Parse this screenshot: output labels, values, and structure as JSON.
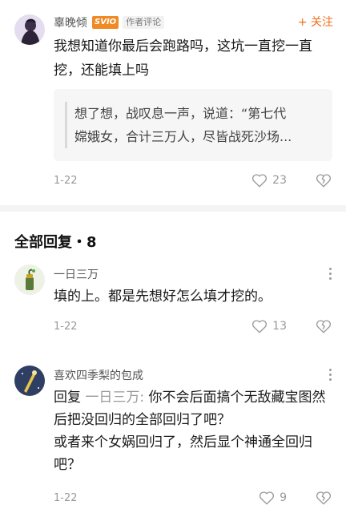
{
  "main_comment": {
    "author": "辜晚倾",
    "level_badge": "SVIO",
    "role_tag": "作者评论",
    "follow_label": "+ 关注",
    "text": "我想知道你最后会跑路吗，这坑一直挖一直挖，还能填上吗",
    "quote_line1": "想了想，战叹息一声，说道：“第七代",
    "quote_line2": "嫦娥女，合计三万人，尽皆战死沙场...",
    "date": "1-22",
    "likes": "23"
  },
  "replies_header": "全部回复・8",
  "replies": [
    {
      "author": "一日三万",
      "text": "填的上。都是先想好怎么填才挖的。",
      "date": "1-22",
      "likes": "13"
    },
    {
      "author": "喜欢四季梨的包成",
      "reply_prefix": "回复",
      "reply_target": "一日三万:",
      "text_line1": "你不会后面搞个无敌藏宝图然",
      "text_line2": "后把没回归的全部回归了吧？",
      "text_line3": "或者来个女娲回归了，然后显个神通全回归",
      "text_line4": "吧？",
      "date": "1-22",
      "likes": "9"
    }
  ],
  "colors": {
    "accent": "#f26d1c",
    "badge": "#f08a24",
    "muted": "#999999"
  },
  "icons": [
    "like-icon",
    "dislike-icon",
    "more-icon"
  ]
}
